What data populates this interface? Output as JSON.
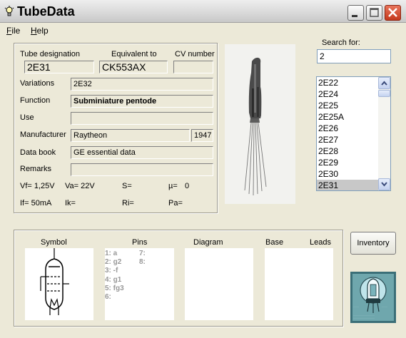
{
  "window": {
    "title": "TubeData"
  },
  "menu": {
    "file": "File",
    "help": "Help"
  },
  "header_labels": {
    "designation": "Tube designation",
    "equivalent": "Equivalent to",
    "cv": "CV number"
  },
  "tube": {
    "designation": "2E31",
    "equivalent": "CK553AX",
    "cv": "",
    "variations": "2E32",
    "function": "Subminiature pentode",
    "use": "",
    "manufacturer": "Raytheon",
    "year": "1947",
    "data_book": "GE essential data",
    "remarks": ""
  },
  "field_labels": {
    "variations": "Variations",
    "function": "Function",
    "use": "Use",
    "manufacturer": "Manufacturer",
    "data_book": "Data book",
    "remarks": "Remarks"
  },
  "params": {
    "vf": "Vf= 1,25V",
    "va": "Va= 22V",
    "s": "S=",
    "mu": "µ=",
    "mu_value": "0",
    "if": "If= 50mA",
    "ik": "Ik=",
    "ri": "Ri=",
    "pa": "Pa="
  },
  "search": {
    "label": "Search for:",
    "value": "2"
  },
  "list": {
    "items": [
      "2E22",
      "2E24",
      "2E25",
      "2E25A",
      "2E26",
      "2E27",
      "2E28",
      "2E29",
      "2E30",
      "2E31"
    ],
    "selected": "2E31"
  },
  "bottom": {
    "symbol": "Symbol",
    "pins": "Pins",
    "diagram": "Diagram",
    "base": "Base",
    "leads": "Leads",
    "pins_col1": [
      "1: a",
      "2: g2",
      "3: -f",
      "4: g1",
      "5: fg3",
      "6:"
    ],
    "pins_col2": [
      "7:",
      "8:"
    ]
  },
  "buttons": {
    "inventory": "Inventory"
  },
  "icons": {
    "app": "lightbulb-icon",
    "minimize": "minimize-icon",
    "maximize": "maximize-icon",
    "close": "close-icon",
    "scroll_up": "chevron-up-icon",
    "scroll_down": "chevron-down-icon",
    "tube_symbol": "pentode-symbol-icon",
    "logo": "tube-logo-icon"
  },
  "colors": {
    "window_bg": "#ece9d8",
    "close_button": "#c4391c",
    "list_selection": "#c8c8c8",
    "pin_text": "#999999",
    "input_border": "#7f9db9"
  }
}
